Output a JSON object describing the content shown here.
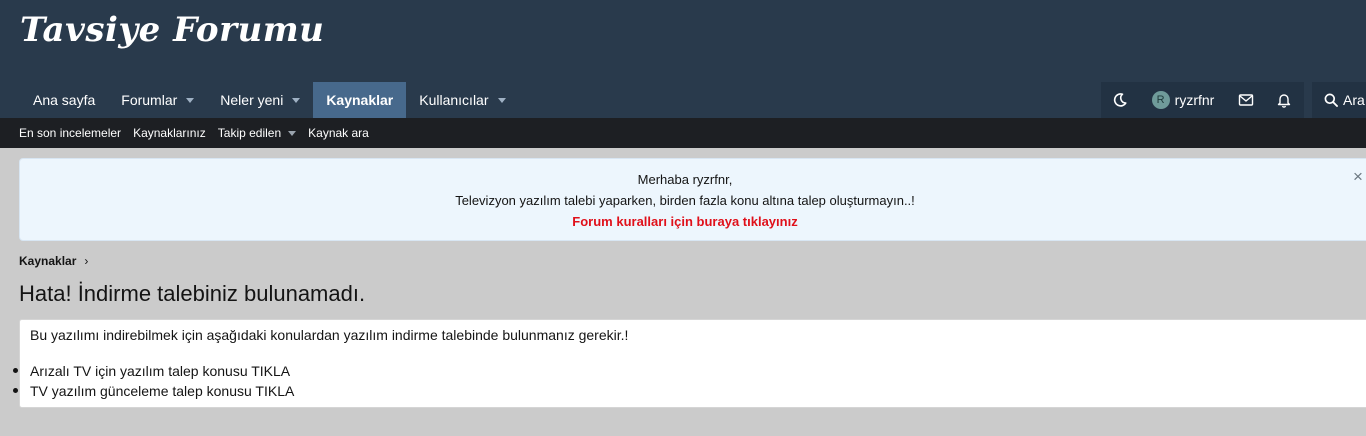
{
  "header": {
    "logo": "Tavsiye Forumu",
    "nav": [
      {
        "label": "Ana sayfa",
        "dropdown": false,
        "active": false
      },
      {
        "label": "Forumlar",
        "dropdown": true,
        "active": false
      },
      {
        "label": "Neler yeni",
        "dropdown": true,
        "active": false
      },
      {
        "label": "Kaynaklar",
        "dropdown": false,
        "active": true
      },
      {
        "label": "Kullanıcılar",
        "dropdown": true,
        "active": false
      }
    ],
    "user": {
      "avatar_letter": "R",
      "username": "ryzrfnr"
    },
    "search_label": "Ara",
    "icons": [
      "moon-icon",
      "mail-icon",
      "bell-icon",
      "search-icon"
    ]
  },
  "subnav": [
    {
      "label": "En son incelemeler",
      "dropdown": false
    },
    {
      "label": "Kaynaklarınız",
      "dropdown": false
    },
    {
      "label": "Takip edilen",
      "dropdown": true
    },
    {
      "label": "Kaynak ara",
      "dropdown": false
    }
  ],
  "notice": {
    "line1": "Merhaba ryzrfnr,",
    "line2": "Televizyon yazılım talebi yaparken, birden fazla konu altına talep oluşturmayın..!",
    "link": "Forum kuralları için buraya tıklayınız",
    "close": "×"
  },
  "breadcrumb": {
    "label": "Kaynaklar",
    "separator": "›"
  },
  "page_title": "Hata! İndirme talebiniz bulunamadı.",
  "content": {
    "text": "Bu yazılımı indirebilmek için aşağıdaki konulardan yazılım indirme talebinde bulunmanız gerekir.!",
    "items": [
      "Arızalı TV için yazılım talep konusu TIKLA",
      "TV yazılım günceleme talep konusu TIKLA"
    ]
  },
  "colors": {
    "header_bg": "#293a4c",
    "nav_active": "#47698c",
    "subnav_bg": "#1d1f23",
    "page_bg": "#cbcbcb",
    "notice_bg": "#edf6fd",
    "link_red": "#e0101a"
  }
}
